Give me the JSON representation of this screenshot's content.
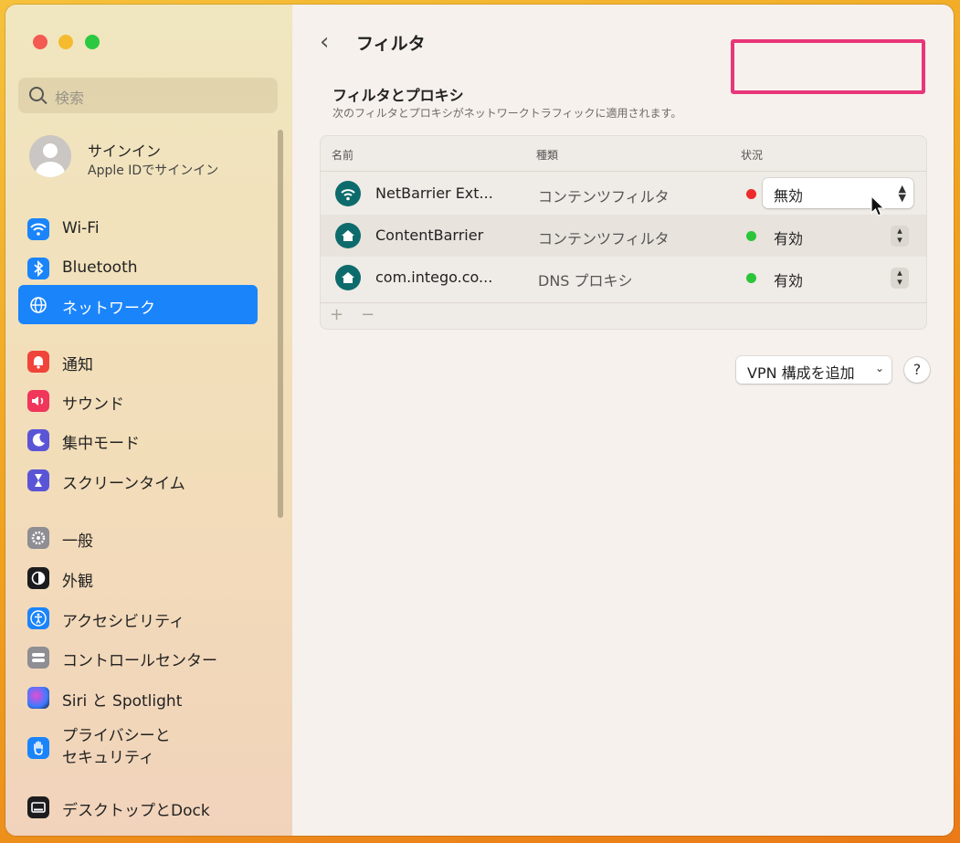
{
  "window": {
    "title": "フィルタ"
  },
  "search": {
    "placeholder": "検索"
  },
  "profile": {
    "name": "サインイン",
    "subtitle": "Apple IDでサインイン"
  },
  "sidebar": {
    "items": [
      {
        "label": "Wi-Fi",
        "icon": "wifi-icon",
        "color": "#1a84fb"
      },
      {
        "label": "Bluetooth",
        "icon": "bluetooth-icon",
        "color": "#1a84fb"
      },
      {
        "label": "ネットワーク",
        "icon": "globe-icon",
        "color": "#1a84fb"
      },
      {
        "label": "通知",
        "icon": "bell-icon",
        "color": "#f0443a"
      },
      {
        "label": "サウンド",
        "icon": "speaker-icon",
        "color": "#f0365a"
      },
      {
        "label": "集中モード",
        "icon": "moon-icon",
        "color": "#5a55d6"
      },
      {
        "label": "スクリーンタイム",
        "icon": "hourglass-icon",
        "color": "#5a55d6"
      },
      {
        "label": "一般",
        "icon": "gear-icon",
        "color": "#8e8e93"
      },
      {
        "label": "外観",
        "icon": "appearance-icon",
        "color": "#1c1c1e"
      },
      {
        "label": "アクセシビリティ",
        "icon": "accessibility-icon",
        "color": "#1a84fb"
      },
      {
        "label": "コントロールセンター",
        "icon": "control-center-icon",
        "color": "#8e8e93"
      },
      {
        "label": "Siri と Spotlight",
        "icon": "siri-icon",
        "color": "#2b2b52"
      },
      {
        "label": "プライバシーと\nセキュリティ",
        "icon": "hand-icon",
        "color": "#1a84fb"
      },
      {
        "label": "デスクトップとDock",
        "icon": "dock-icon",
        "color": "#1c1c1e"
      }
    ],
    "active": "ネットワーク"
  },
  "section": {
    "title": "フィルタとプロキシ",
    "subtitle": "次のフィルタとプロキシがネットワークトラフィックに適用されます。"
  },
  "table": {
    "headers": {
      "name": "名前",
      "type": "種類",
      "status": "状況"
    },
    "rows": [
      {
        "name": "NetBarrier Ext...",
        "type": "コンテンツフィルタ",
        "status": "無効",
        "status_color": "#ee2a2a"
      },
      {
        "name": "ContentBarrier",
        "type": "コンテンツフィルタ",
        "status": "有効",
        "status_color": "#2bc53a"
      },
      {
        "name": "com.intego.co...",
        "type": "DNS プロキシ",
        "status": "有効",
        "status_color": "#2bc53a"
      }
    ],
    "add_label": "+",
    "remove_label": "−"
  },
  "vpn": {
    "label": "VPN 構成を追加"
  },
  "help": {
    "label": "?"
  },
  "highlight_color": "#e8367a"
}
